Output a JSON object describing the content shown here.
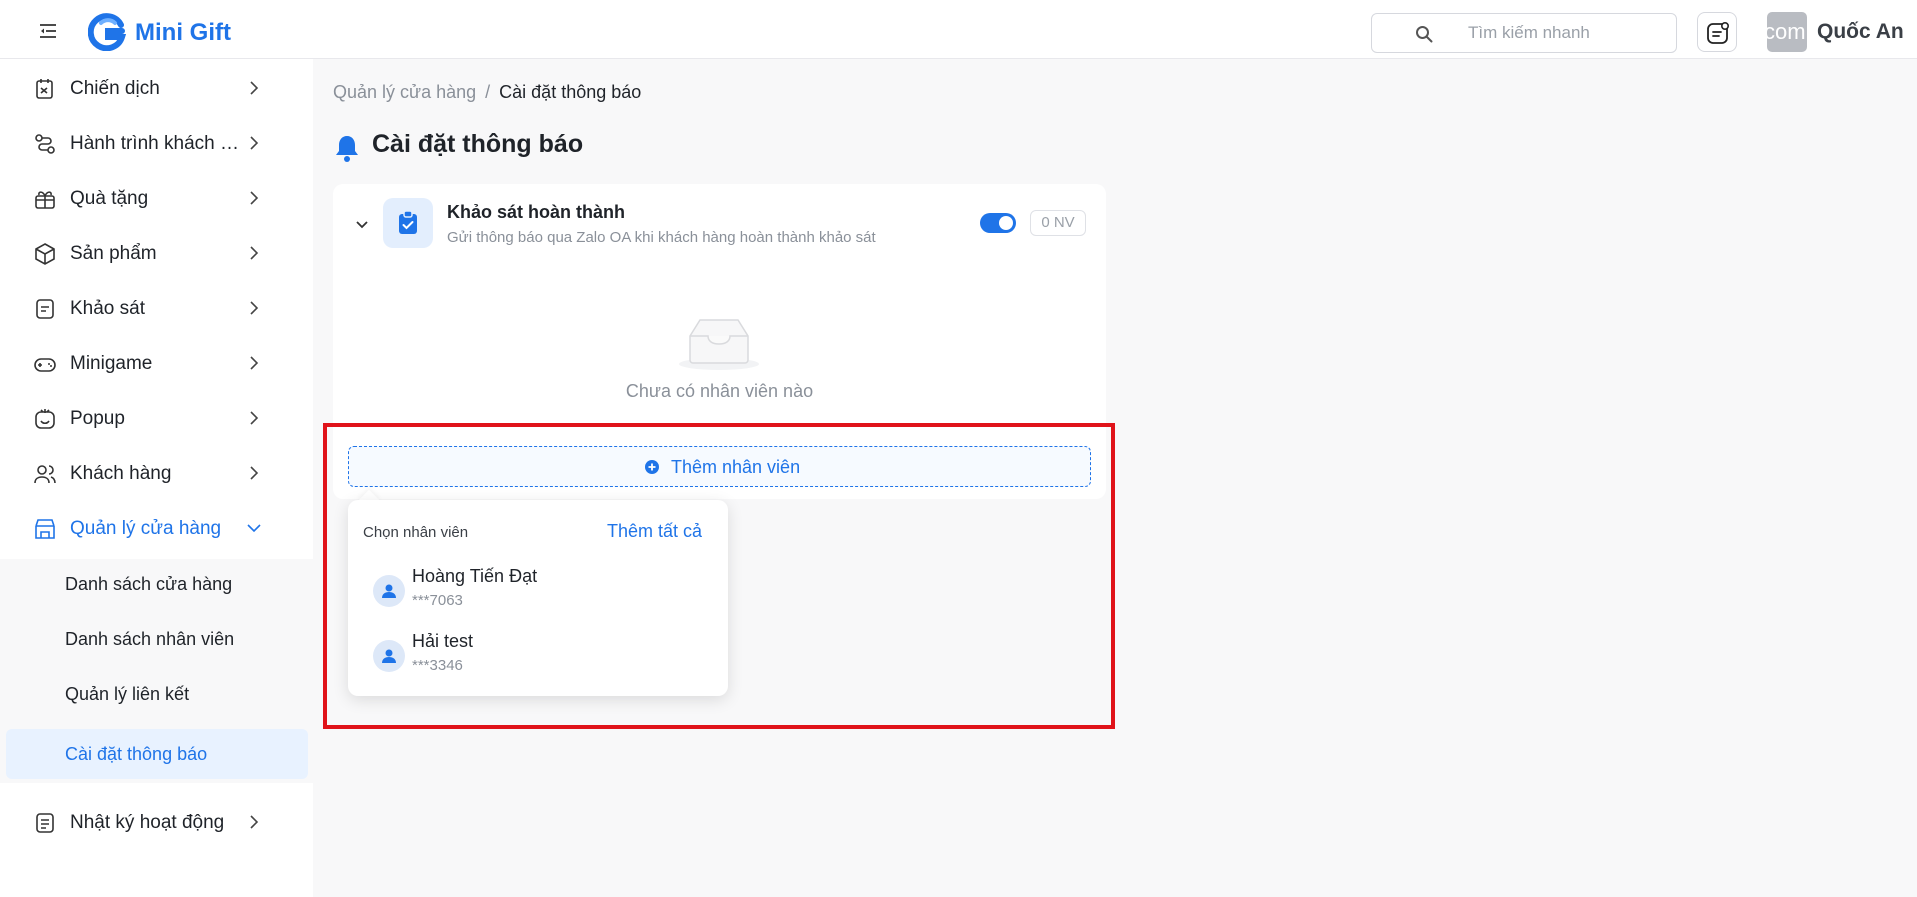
{
  "app": {
    "name": "Mini Gift"
  },
  "header": {
    "search_placeholder": "Tìm kiếm nhanh",
    "avatar_text": "com",
    "user_name": "Quốc An"
  },
  "sidebar": {
    "items": [
      {
        "label": "Chiến dịch",
        "icon": "campaign-icon"
      },
      {
        "label": "Hành trình khách hàng",
        "icon": "journey-icon"
      },
      {
        "label": "Quà tặng",
        "icon": "gift-icon"
      },
      {
        "label": "Sản phẩm",
        "icon": "product-icon"
      },
      {
        "label": "Khảo sát",
        "icon": "survey-icon"
      },
      {
        "label": "Minigame",
        "icon": "gamepad-icon"
      },
      {
        "label": "Popup",
        "icon": "popup-icon"
      },
      {
        "label": "Khách hàng",
        "icon": "users-icon"
      },
      {
        "label": "Quản lý cửa hàng",
        "icon": "store-icon"
      },
      {
        "label": "Nhật ký hoạt động",
        "icon": "log-icon"
      }
    ],
    "submenu": [
      {
        "label": "Danh sách cửa hàng"
      },
      {
        "label": "Danh sách nhân viên"
      },
      {
        "label": "Quản lý liên kết"
      },
      {
        "label": "Cài đặt thông báo"
      }
    ]
  },
  "breadcrumb": {
    "parent": "Quản lý cửa hàng",
    "separator": "/",
    "current": "Cài đặt thông báo"
  },
  "page": {
    "title": "Cài đặt thông báo"
  },
  "notification_card": {
    "title": "Khảo sát hoàn thành",
    "description": "Gửi thông báo qua Zalo OA khi khách hàng hoàn thành khảo sát",
    "enabled": true,
    "count_label": "0 NV",
    "empty_text": "Chưa có nhân viên nào"
  },
  "add_employee": {
    "label": "Thêm nhân viên"
  },
  "popover": {
    "title": "Chọn nhân viên",
    "add_all_label": "Thêm tất cả",
    "employees": [
      {
        "name": "Hoàng Tiến Đạt",
        "phone": "***7063"
      },
      {
        "name": "Hải test",
        "phone": "***3346"
      }
    ]
  },
  "colors": {
    "primary": "#1f74e8",
    "highlight": "#e0131a",
    "text": "#1f2329",
    "muted": "#8a9099"
  }
}
